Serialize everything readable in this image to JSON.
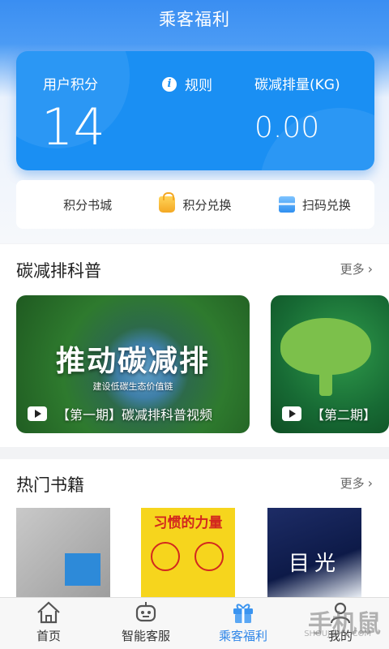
{
  "header": {
    "title": "乘客福利"
  },
  "points_card": {
    "points_label": "用户积分",
    "points_value": "14",
    "rules_label": "规则",
    "carbon_label": "碳减排量(KG)",
    "carbon_value": "0.00"
  },
  "quick_actions": [
    {
      "label": "积分书城",
      "icon": "book-icon"
    },
    {
      "label": "积分兑换",
      "icon": "shopping-bag-icon"
    },
    {
      "label": "扫码兑换",
      "icon": "scan-icon"
    }
  ],
  "carbon_section": {
    "title": "碳减排科普",
    "more": "更多",
    "videos": [
      {
        "cover_title": "推动碳减排",
        "cover_subtitle": "建设低碳生态价值链",
        "caption": "【第一期】碳减排科普视频"
      },
      {
        "caption": "【第二期】"
      }
    ]
  },
  "books_section": {
    "title": "热门书籍",
    "more": "更多",
    "books": [
      {
        "cover_text": ""
      },
      {
        "cover_text": "习惯的力量"
      },
      {
        "cover_text": "目光"
      }
    ]
  },
  "bottom_nav": [
    {
      "label": "首页",
      "icon": "home-icon",
      "active": false
    },
    {
      "label": "智能客服",
      "icon": "robot-icon",
      "active": false
    },
    {
      "label": "乘客福利",
      "icon": "gift-icon",
      "active": true
    },
    {
      "label": "我的",
      "icon": "user-icon",
      "active": false
    }
  ],
  "watermark": {
    "text": "手机鼠",
    "sub": "SHOUJISHU.COM"
  },
  "colors": {
    "primary": "#1a8ff3",
    "active_nav": "#2f86e8"
  }
}
